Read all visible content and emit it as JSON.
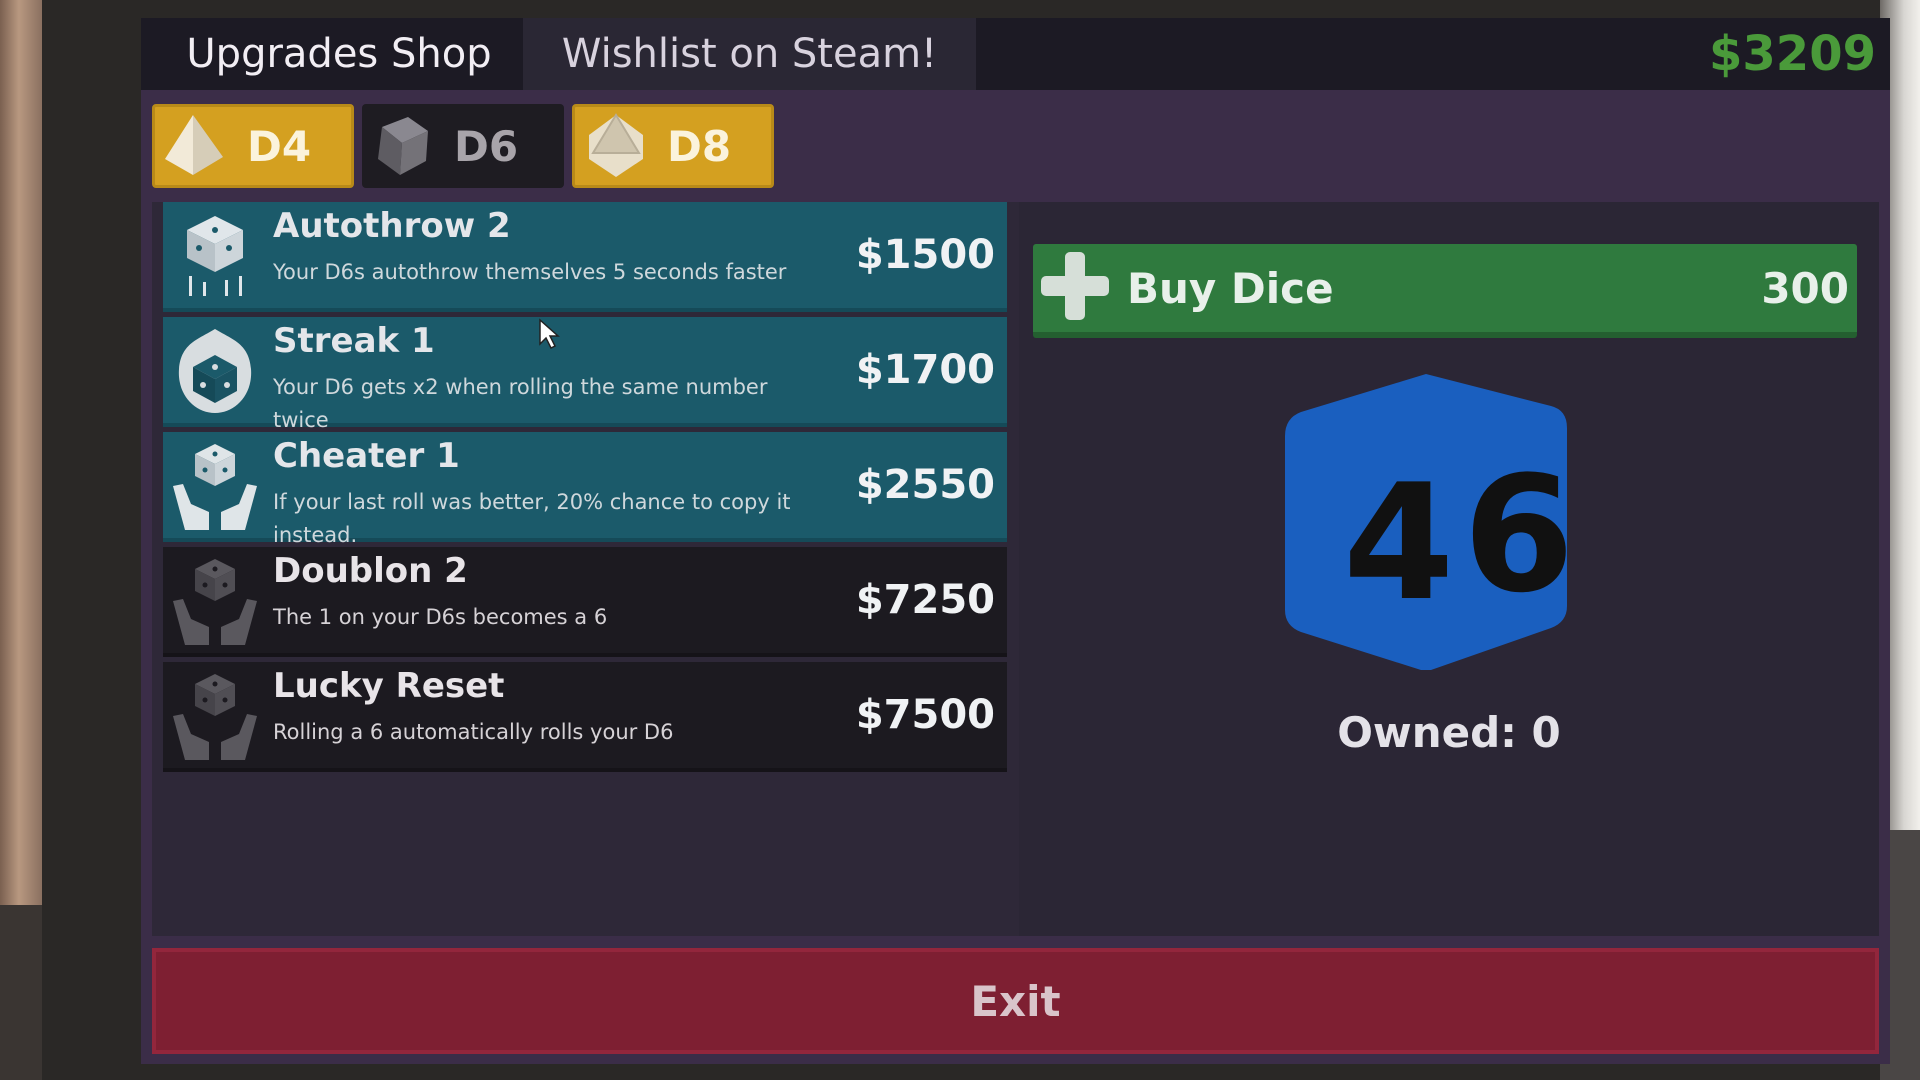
{
  "tabs": {
    "upgrades_shop": "Upgrades Shop",
    "wishlist": "Wishlist on Steam!"
  },
  "money": "$3209",
  "dice_tabs": [
    {
      "label": "D4",
      "state": "unlocked",
      "color": "#d4a020"
    },
    {
      "label": "D6",
      "state": "selected",
      "color": "#1e1c22"
    },
    {
      "label": "D8",
      "state": "unlocked",
      "color": "#d4a020"
    }
  ],
  "upgrades": [
    {
      "name": "Autothrow 2",
      "description": "Your D6s autothrow themselves 5 seconds faster",
      "price": "$1500",
      "affordable": true,
      "icon": "dice-autothrow-icon"
    },
    {
      "name": "Streak 1",
      "description": "Your D6 gets x2 when rolling the same number twice",
      "price": "$1700",
      "affordable": true,
      "icon": "dice-fire-icon"
    },
    {
      "name": "Cheater 1",
      "description": "If your last roll was better, 20% chance to copy it instead.",
      "price": "$2550",
      "affordable": true,
      "icon": "dice-hands-icon"
    },
    {
      "name": "Doublon 2",
      "description": "The 1 on your D6s becomes a 6",
      "price": "$7250",
      "affordable": false,
      "icon": "dice-hands-icon"
    },
    {
      "name": "Lucky Reset",
      "description": "Rolling a 6 automatically rolls your D6",
      "price": "$7500",
      "affordable": false,
      "icon": "dice-hands-icon"
    }
  ],
  "buy": {
    "label": "Buy Dice",
    "cost": "300"
  },
  "preview": {
    "face_left": "4",
    "face_right": "6",
    "die_color": "#1a5fbf"
  },
  "owned": "Owned: 0",
  "exit_label": "Exit",
  "colors": {
    "money": "#4a9a3a",
    "teal_row": "#1b5a6a",
    "dark_row": "#1c1a20",
    "buy": "#2f7a3e",
    "exit": "#7e1f32"
  }
}
